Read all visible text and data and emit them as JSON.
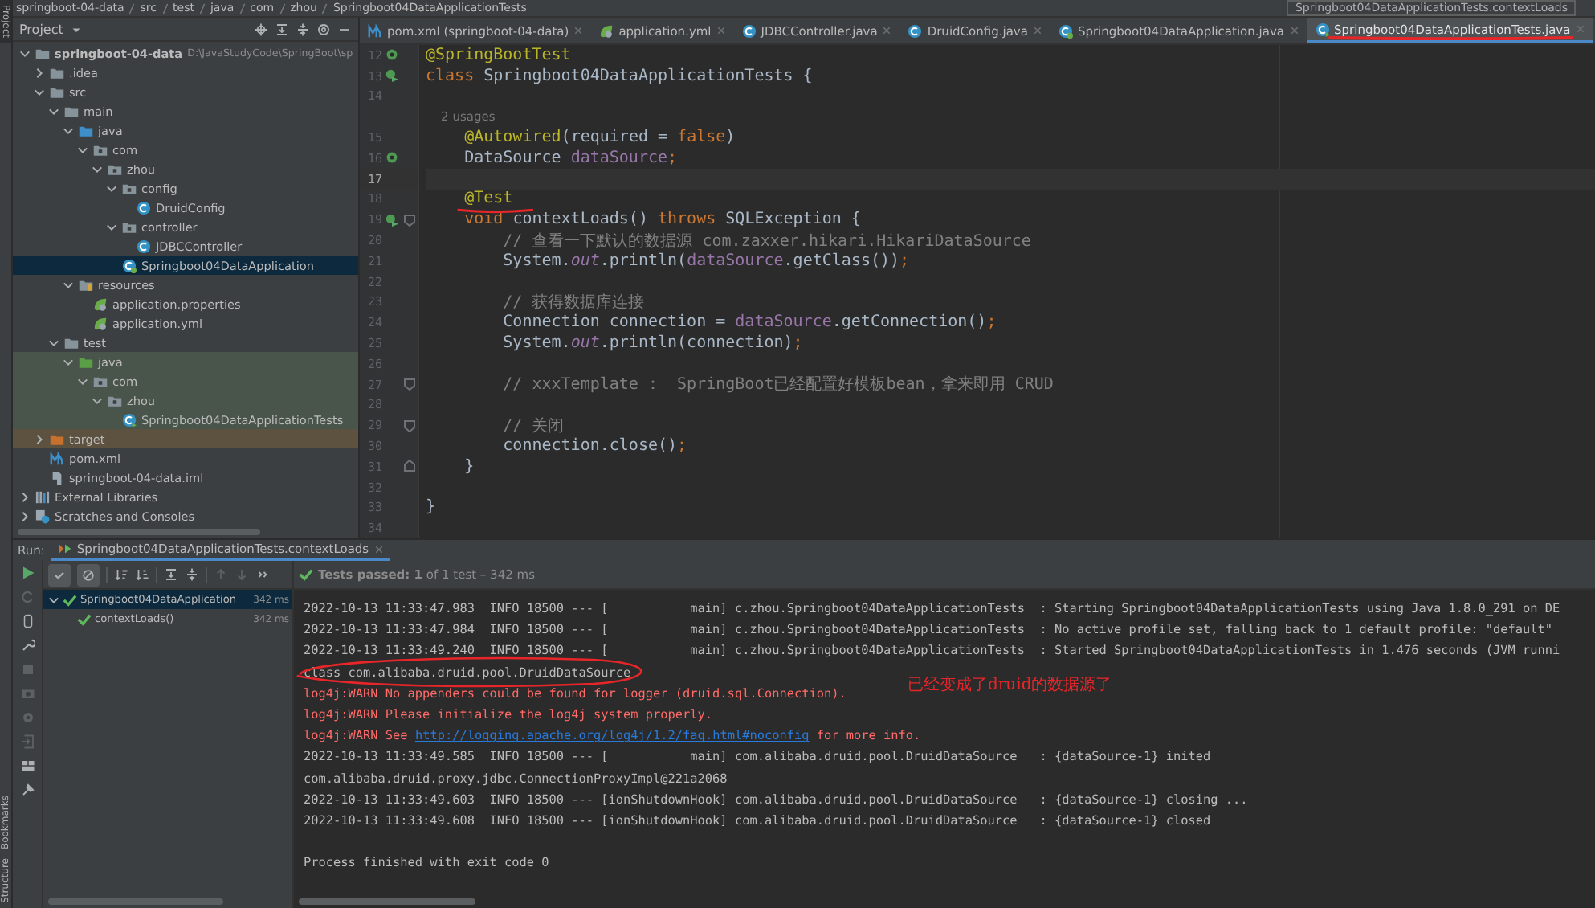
{
  "breadcrumbs": [
    "springboot-04-data",
    "src",
    "test",
    "java",
    "com",
    "zhou",
    "Springboot04DataApplicationTests"
  ],
  "run_config": {
    "label": "Springboot04DataApplicationTests.contextLoads"
  },
  "project_stripe": {
    "label": "Project",
    "selected": true
  },
  "bottom_stripes": [
    "Bookmarks",
    "Structure"
  ],
  "project": {
    "title": "Project",
    "tree": [
      {
        "label": "springboot-04-data",
        "path": "D:\\JavaStudyCode\\SpringBoot\\sp",
        "kind": "module",
        "expanded": true,
        "selected": false,
        "children": [
          {
            "label": ".idea",
            "kind": "folder",
            "expanded": false,
            "selected": false
          },
          {
            "label": "src",
            "kind": "folder",
            "expanded": true,
            "selected": false,
            "children": [
              {
                "label": "main",
                "kind": "folder",
                "expanded": true,
                "selected": false,
                "children": [
                  {
                    "label": "java",
                    "kind": "source",
                    "expanded": true,
                    "selected": false,
                    "children": [
                      {
                        "label": "com",
                        "kind": "package",
                        "expanded": true,
                        "selected": false,
                        "children": [
                          {
                            "label": "zhou",
                            "kind": "package",
                            "expanded": true,
                            "selected": false,
                            "children": [
                              {
                                "label": "config",
                                "kind": "package",
                                "expanded": true,
                                "selected": false,
                                "children": [
                                  {
                                    "label": "DruidConfig",
                                    "kind": "class",
                                    "selected": false
                                  }
                                ]
                              },
                              {
                                "label": "controller",
                                "kind": "package",
                                "expanded": true,
                                "selected": false,
                                "children": [
                                  {
                                    "label": "JDBCController",
                                    "kind": "class",
                                    "selected": false
                                  }
                                ]
                              },
                              {
                                "label": "Springboot04DataApplication",
                                "kind": "boot-class",
                                "selected": true
                              }
                            ]
                          }
                        ]
                      }
                    ]
                  },
                  {
                    "label": "resources",
                    "kind": "resources",
                    "expanded": true,
                    "selected": false,
                    "children": [
                      {
                        "label": "application.properties",
                        "kind": "spring-config",
                        "selected": false
                      },
                      {
                        "label": "application.yml",
                        "kind": "spring-config",
                        "selected": false
                      }
                    ]
                  }
                ]
              },
              {
                "label": "test",
                "kind": "folder",
                "expanded": true,
                "selected": false,
                "children": [
                  {
                    "label": "java",
                    "kind": "test-source",
                    "color": "#49544a",
                    "expanded": true,
                    "selected": false,
                    "children": [
                      {
                        "label": "com",
                        "kind": "package",
                        "color": "#49544a",
                        "expanded": true,
                        "selected": false,
                        "children": [
                          {
                            "label": "zhou",
                            "kind": "package",
                            "color": "#49544a",
                            "expanded": true,
                            "selected": false,
                            "children": [
                              {
                                "label": "Springboot04DataApplicationTests",
                                "kind": "test-class",
                                "color": "#49544a",
                                "selected": false
                              }
                            ]
                          }
                        ]
                      }
                    ]
                  }
                ]
              }
            ]
          },
          {
            "label": "target",
            "kind": "excluded",
            "color": "#5d5140",
            "expanded": false,
            "selected": false
          },
          {
            "label": "pom.xml",
            "kind": "maven",
            "selected": false
          },
          {
            "label": "springboot-04-data.iml",
            "kind": "iml",
            "selected": false
          }
        ]
      },
      {
        "label": "External Libraries",
        "kind": "libraries",
        "expanded": false,
        "selected": false
      },
      {
        "label": "Scratches and Consoles",
        "kind": "scratches",
        "expanded": false,
        "selected": false
      }
    ]
  },
  "editor": {
    "tabs": [
      {
        "label": "pom.xml (springboot-04-data)",
        "kind": "maven",
        "selected": false,
        "underlined": false
      },
      {
        "label": "application.yml",
        "kind": "spring-config",
        "selected": false,
        "underlined": false
      },
      {
        "label": "JDBCController.java",
        "kind": "class",
        "selected": false,
        "underlined": false
      },
      {
        "label": "DruidConfig.java",
        "kind": "class",
        "selected": false,
        "underlined": false
      },
      {
        "label": "Springboot04DataApplication.java",
        "kind": "boot-class",
        "selected": false,
        "underlined": false
      },
      {
        "label": "Springboot04DataApplicationTests.java",
        "kind": "test-class",
        "selected": true,
        "underlined": true
      }
    ],
    "lines": [
      {
        "kind": "code",
        "number": "12",
        "markers": [
          {
            "kind": "bean"
          }
        ],
        "current": false,
        "tokens": [
          {
            "kind": "a",
            "text": "@SpringBootTest"
          }
        ]
      },
      {
        "kind": "code",
        "number": "13",
        "markers": [
          {
            "kind": "run"
          }
        ],
        "current": false,
        "tokens": [
          {
            "kind": "k",
            "text": "class "
          },
          {
            "kind": "p",
            "text": "Springboot04DataApplicationTests {"
          }
        ]
      },
      {
        "kind": "code",
        "number": "14",
        "current": false
      },
      {
        "kind": "inlay",
        "text": "    2 usages"
      },
      {
        "kind": "code",
        "number": "15",
        "current": false,
        "tokens": [
          {
            "kind": "a",
            "text": "    @Autowired"
          },
          {
            "kind": "p",
            "text": "(required = "
          },
          {
            "kind": "k",
            "text": "false"
          },
          {
            "kind": "p",
            "text": ")"
          }
        ]
      },
      {
        "kind": "code",
        "number": "16",
        "markers": [
          {
            "kind": "bean"
          }
        ],
        "current": false,
        "tokens": [
          {
            "kind": "p",
            "text": "    DataSource "
          },
          {
            "kind": "f",
            "text": "dataSource"
          },
          {
            "kind": "k",
            "text": ";"
          }
        ]
      },
      {
        "kind": "code",
        "number": "17",
        "current": true
      },
      {
        "kind": "code",
        "number": "18",
        "current": false,
        "tokens": [
          {
            "kind": "a",
            "text": "    @Test",
            "underlined": true
          }
        ]
      },
      {
        "kind": "code",
        "number": "19",
        "markers": [
          {
            "kind": "run"
          },
          {
            "kind": "fold-start"
          }
        ],
        "current": false,
        "tokens": [
          {
            "kind": "k",
            "text": "    void "
          },
          {
            "kind": "p",
            "text": "contextLoads() "
          },
          {
            "kind": "k",
            "text": "throws "
          },
          {
            "kind": "p",
            "text": "SQLException {"
          }
        ]
      },
      {
        "kind": "code",
        "number": "20",
        "current": false,
        "tokens": [
          {
            "kind": "c",
            "text": "        // 查看一下默认的数据源 com.zaxxer.hikari.HikariDataSource"
          }
        ]
      },
      {
        "kind": "code",
        "number": "21",
        "current": false,
        "tokens": [
          {
            "kind": "p",
            "text": "        System."
          },
          {
            "kind": "s",
            "text": "out"
          },
          {
            "kind": "p",
            "text": ".println("
          },
          {
            "kind": "f",
            "text": "dataSource"
          },
          {
            "kind": "p",
            "text": ".getClass())"
          },
          {
            "kind": "k",
            "text": ";"
          }
        ]
      },
      {
        "kind": "code",
        "number": "22",
        "current": false
      },
      {
        "kind": "code",
        "number": "23",
        "current": false,
        "tokens": [
          {
            "kind": "c",
            "text": "        // 获得数据库连接"
          }
        ]
      },
      {
        "kind": "code",
        "number": "24",
        "current": false,
        "tokens": [
          {
            "kind": "p",
            "text": "        Connection connection = "
          },
          {
            "kind": "f",
            "text": "dataSource"
          },
          {
            "kind": "p",
            "text": ".getConnection()"
          },
          {
            "kind": "k",
            "text": ";"
          }
        ]
      },
      {
        "kind": "code",
        "number": "25",
        "current": false,
        "tokens": [
          {
            "kind": "p",
            "text": "        System."
          },
          {
            "kind": "s",
            "text": "out"
          },
          {
            "kind": "p",
            "text": ".println(connection)"
          },
          {
            "kind": "k",
            "text": ";"
          }
        ]
      },
      {
        "kind": "code",
        "number": "26",
        "current": false
      },
      {
        "kind": "code",
        "number": "27",
        "markers": [
          {
            "kind": "fold-start"
          }
        ],
        "current": false,
        "tokens": [
          {
            "kind": "c",
            "text": "        // xxxTemplate :  SpringBoot已经配置好模板bean，拿来即用 CRUD"
          }
        ]
      },
      {
        "kind": "code",
        "number": "28",
        "current": false
      },
      {
        "kind": "code",
        "number": "29",
        "markers": [
          {
            "kind": "fold-start"
          }
        ],
        "current": false,
        "tokens": [
          {
            "kind": "c",
            "text": "        // 关闭"
          }
        ]
      },
      {
        "kind": "code",
        "number": "30",
        "current": false,
        "tokens": [
          {
            "kind": "p",
            "text": "        connection.close()"
          },
          {
            "kind": "k",
            "text": ";"
          }
        ]
      },
      {
        "kind": "code",
        "number": "31",
        "markers": [
          {
            "kind": "fold-end"
          }
        ],
        "current": false,
        "tokens": [
          {
            "kind": "p",
            "text": "    }"
          }
        ]
      },
      {
        "kind": "code",
        "number": "32",
        "current": false
      },
      {
        "kind": "code",
        "number": "33",
        "current": false,
        "tokens": [
          {
            "kind": "p",
            "text": "}"
          }
        ]
      },
      {
        "kind": "code",
        "number": "34",
        "current": false
      }
    ]
  },
  "run": {
    "label": "Run:",
    "tab": {
      "label": "Springboot04DataApplicationTests.contextLoads",
      "selected": true
    },
    "filters": [
      {
        "selected": true
      },
      {
        "selected": true
      }
    ],
    "status": "**Tests passed: 1** of 1 test – 342 ms",
    "tests": [
      {
        "name": "Springboot04DataApplication",
        "time": "342 ms",
        "passed": true,
        "selected": true,
        "expanded": true,
        "children": [
          {
            "name": "contextLoads()",
            "time": "342 ms",
            "passed": true,
            "selected": false
          }
        ]
      }
    ],
    "console": [
      {
        "kind": "info",
        "text": "2022-10-13 11:33:47.983  INFO 18500 --- [           main] c.zhou.Springboot04DataApplicationTests  : Starting Springboot04DataApplicationTests using Java 1.8.0_291 on DE"
      },
      {
        "kind": "info",
        "text": "2022-10-13 11:33:47.984  INFO 18500 --- [           main] c.zhou.Springboot04DataApplicationTests  : No active profile set, falling back to 1 default profile: \"default\""
      },
      {
        "kind": "info",
        "text": "2022-10-13 11:33:49.240  INFO 18500 --- [           main] c.zhou.Springboot04DataApplicationTests  : Started Springboot04DataApplicationTests in 1.476 seconds (JVM runni"
      },
      {
        "kind": "out",
        "text": "class com.alibaba.druid.pool.DruidDataSource",
        "circled": true
      },
      {
        "kind": "warn",
        "text": "log4j:WARN No appenders could be found for logger (druid.sql.Connection)."
      },
      {
        "kind": "warn",
        "text": "log4j:WARN Please initialize the log4j system properly."
      },
      {
        "kind": "warn",
        "parts": [
          {
            "kind": "text",
            "text": "log4j:WARN See "
          },
          {
            "kind": "link",
            "text": "http://logging.apache.org/log4j/1.2/faq.html#noconfig"
          },
          {
            "kind": "text",
            "text": " for more info."
          }
        ]
      },
      {
        "kind": "info",
        "text": "2022-10-13 11:33:49.585  INFO 18500 --- [           main] com.alibaba.druid.pool.DruidDataSource   : {dataSource-1} inited"
      },
      {
        "kind": "out",
        "text": "com.alibaba.druid.proxy.jdbc.ConnectionProxyImpl@221a2068"
      },
      {
        "kind": "info",
        "text": "2022-10-13 11:33:49.603  INFO 18500 --- [ionShutdownHook] com.alibaba.druid.pool.DruidDataSource   : {dataSource-1} closing ..."
      },
      {
        "kind": "info",
        "text": "2022-10-13 11:33:49.608  INFO 18500 --- [ionShutdownHook] com.alibaba.druid.pool.DruidDataSource   : {dataSource-1} closed"
      },
      {
        "kind": "exit",
        "text": "Process finished with exit code 0"
      }
    ],
    "note": "已经变成了druid的数据源了"
  }
}
